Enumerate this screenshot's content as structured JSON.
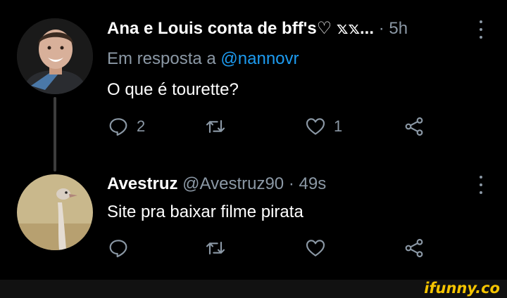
{
  "tweets": [
    {
      "display_name": "Ana e Louis conta de bff's♡ 𝕩𝕩...",
      "time": "5h",
      "reply_prefix": "Em resposta a",
      "reply_mention": "@nannovr",
      "text": "O que é tourette?",
      "replies": "2",
      "retweets": "",
      "likes": "1"
    },
    {
      "display_name": "Avestruz",
      "handle": "@Avestruz90",
      "time": "49s",
      "text": "Site pra baixar filme pirata",
      "replies": "",
      "retweets": "",
      "likes": ""
    }
  ],
  "separator": "·",
  "watermark": "ifunny.co",
  "colors": {
    "muted": "#8b98a5",
    "mention": "#1d9bf0",
    "brand": "#f5c400"
  }
}
